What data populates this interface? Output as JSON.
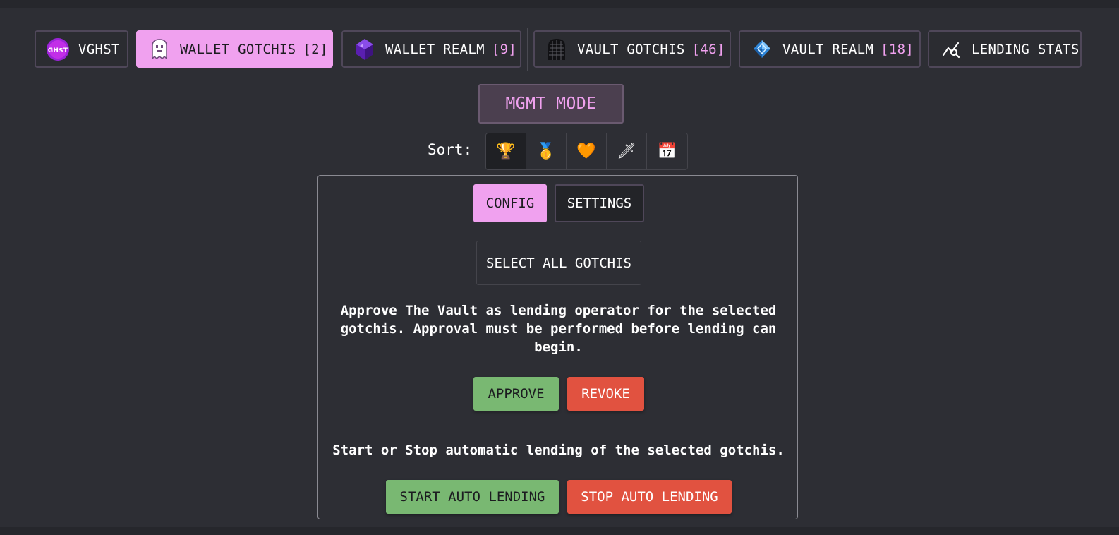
{
  "nav": {
    "tabs": [
      {
        "label": "VGHST",
        "count": "",
        "icon": "ghst-coin-icon"
      },
      {
        "label": "WALLET GOTCHIS",
        "count": "[2]",
        "icon": "gotchi-ghost-icon",
        "active": true
      },
      {
        "label": "WALLET REALM",
        "count": "[9]",
        "icon": "purple-crystal-icon"
      },
      {
        "label": "VAULT GOTCHIS",
        "count": "[46]",
        "icon": "vault-gotchi-icon"
      },
      {
        "label": "VAULT REALM",
        "count": "[18]",
        "icon": "blue-crystal-icon"
      },
      {
        "label": "LENDING STATS",
        "count": "",
        "icon": "chart-search-icon"
      }
    ],
    "ghst_icon_text": "GH$T"
  },
  "mgmt": {
    "label": "MGMT MODE"
  },
  "sort": {
    "label": "Sort:",
    "options": [
      {
        "icon": "trophy-icon",
        "glyph": "🏆",
        "active": true
      },
      {
        "icon": "medal-icon",
        "glyph": "🥇"
      },
      {
        "icon": "orange-heart-icon",
        "glyph": "🧡"
      },
      {
        "icon": "dagger-icon",
        "glyph": "🗡"
      },
      {
        "icon": "calendar-icon",
        "glyph": "📅"
      }
    ]
  },
  "panel": {
    "tabs": {
      "config": "CONFIG",
      "settings": "SETTINGS"
    },
    "select_all": "SELECT ALL GOTCHIS",
    "approve_text": "Approve The Vault as lending operator for the selected gotchis. Approval must be performed before lending can begin.",
    "approve_label": "APPROVE",
    "revoke_label": "REVOKE",
    "auto_text": "Start or Stop automatic lending of the selected gotchis.",
    "start_label": "START AUTO LENDING",
    "stop_label": "STOP AUTO LENDING"
  },
  "colors": {
    "accent_pink": "#f0a1ef",
    "approve_green": "#79b872",
    "revoke_red": "#e15240",
    "background": "#2d2e34"
  }
}
